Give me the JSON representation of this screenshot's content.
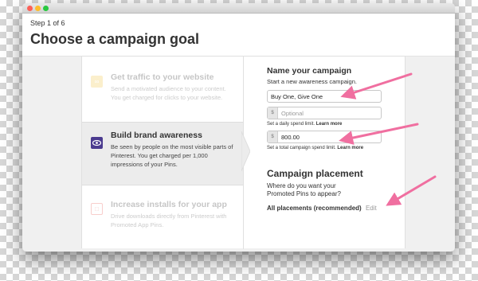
{
  "window": {
    "step": "Step 1 of 6",
    "title": "Choose a campaign goal"
  },
  "goals": [
    {
      "title": "Get traffic to your website",
      "description": "Send a motivated audience to your content. You get charged for clicks to your website.",
      "icon": "link-icon",
      "color": "#f2c94c",
      "state": "faded"
    },
    {
      "title": "Build brand awareness",
      "description": "Be seen by people on the most visible parts of Pinterest. You get charged per 1,000 impressions of your Pins.",
      "icon": "eye-icon",
      "color": "#4b3b8f",
      "state": "selected"
    },
    {
      "title": "Increase installs for your app",
      "description": "Drive downloads directly from Pinterest with Promoted App Pins.",
      "icon": "app-icon",
      "color": "#e8524a",
      "state": "faded"
    }
  ],
  "campaign": {
    "heading": "Name your campaign",
    "subtext": "Start a new awareness campaign.",
    "name_value": "Buy One, Give One",
    "daily_prefix": "$",
    "daily_placeholder": "Optional",
    "daily_hint": "Set a daily spend limit.",
    "daily_link": "Learn more",
    "total_prefix": "$",
    "total_value": "800.00",
    "total_hint": "Set a total campaign spend limit.",
    "total_link": "Learn more"
  },
  "placement": {
    "heading": "Campaign placement",
    "question": "Where do you want your Promoted Pins to appear?",
    "value": "All placements (recommended)",
    "edit": "Edit"
  },
  "colors": {
    "arrow": "#f06fa0",
    "selected_icon": "#4b3b8f",
    "traffic_icon": "#f2c94c",
    "app_icon": "#e8524a"
  }
}
